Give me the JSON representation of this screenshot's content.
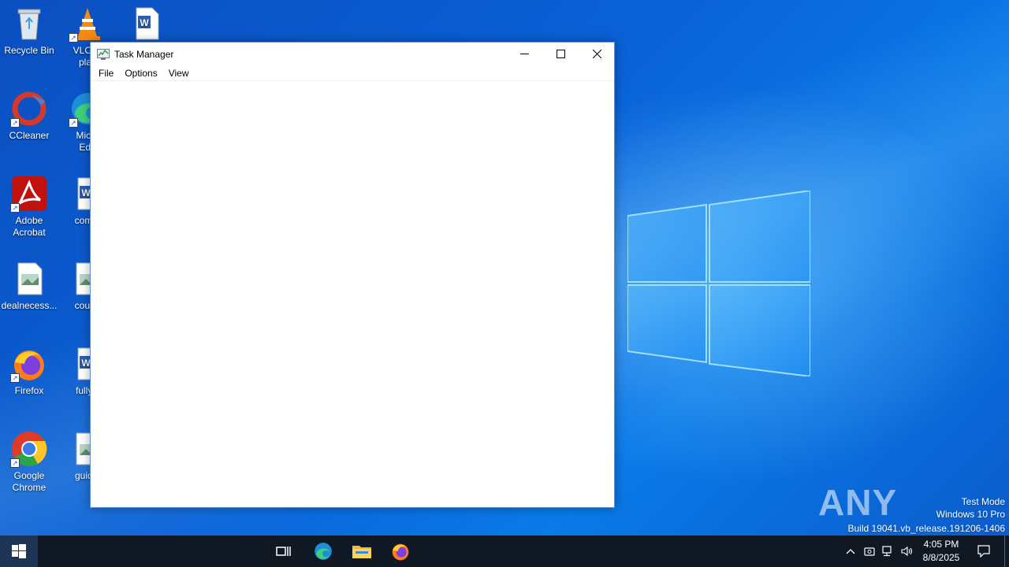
{
  "desktop": {
    "icons": [
      {
        "label": "Recycle Bin",
        "icon": "recycle-bin-icon"
      },
      {
        "label": "VLC m\nplay",
        "icon": "vlc-icon"
      },
      {
        "label": "",
        "icon": "word-doc-icon"
      },
      {
        "label": "CCleaner",
        "icon": "ccleaner-icon"
      },
      {
        "label": "Micro\nEdg",
        "icon": "edge-icon"
      },
      {
        "label": "Adobe\nAcrobat",
        "icon": "acrobat-icon"
      },
      {
        "label": "comm",
        "icon": "word-doc-icon"
      },
      {
        "label": "dealnecess...",
        "icon": "image-file-icon"
      },
      {
        "label": "courtc",
        "icon": "image-file-icon"
      },
      {
        "label": "Firefox",
        "icon": "firefox-icon"
      },
      {
        "label": "fullycl",
        "icon": "word-doc-icon"
      },
      {
        "label": "Google\nChrome",
        "icon": "chrome-icon"
      },
      {
        "label": "guidel",
        "icon": "image-file-icon"
      }
    ]
  },
  "window": {
    "title": "Task Manager",
    "menu": [
      "File",
      "Options",
      "View"
    ],
    "minimize_label": "Minimize",
    "maximize_label": "Maximize",
    "close_label": "Close"
  },
  "watermark": {
    "brand": "ANY RUN",
    "line1": "Test Mode",
    "line2": "Windows 10 Pro",
    "line3": "Build 19041.vb_release.191206-1406"
  },
  "taskbar": {
    "apps": [
      "task-view-icon",
      "edge-icon",
      "file-explorer-icon",
      "firefox-icon"
    ],
    "tray": [
      "chevron-up-icon",
      "meet-now-icon",
      "network-icon",
      "volume-icon"
    ],
    "time": "4:05 PM",
    "date": "8/8/2025",
    "notification_icon": "notification-icon"
  },
  "colors": {
    "desktop_bg": "#0a62d8",
    "taskbar_bg": "#101824",
    "window_border": "#5a8fd6"
  }
}
